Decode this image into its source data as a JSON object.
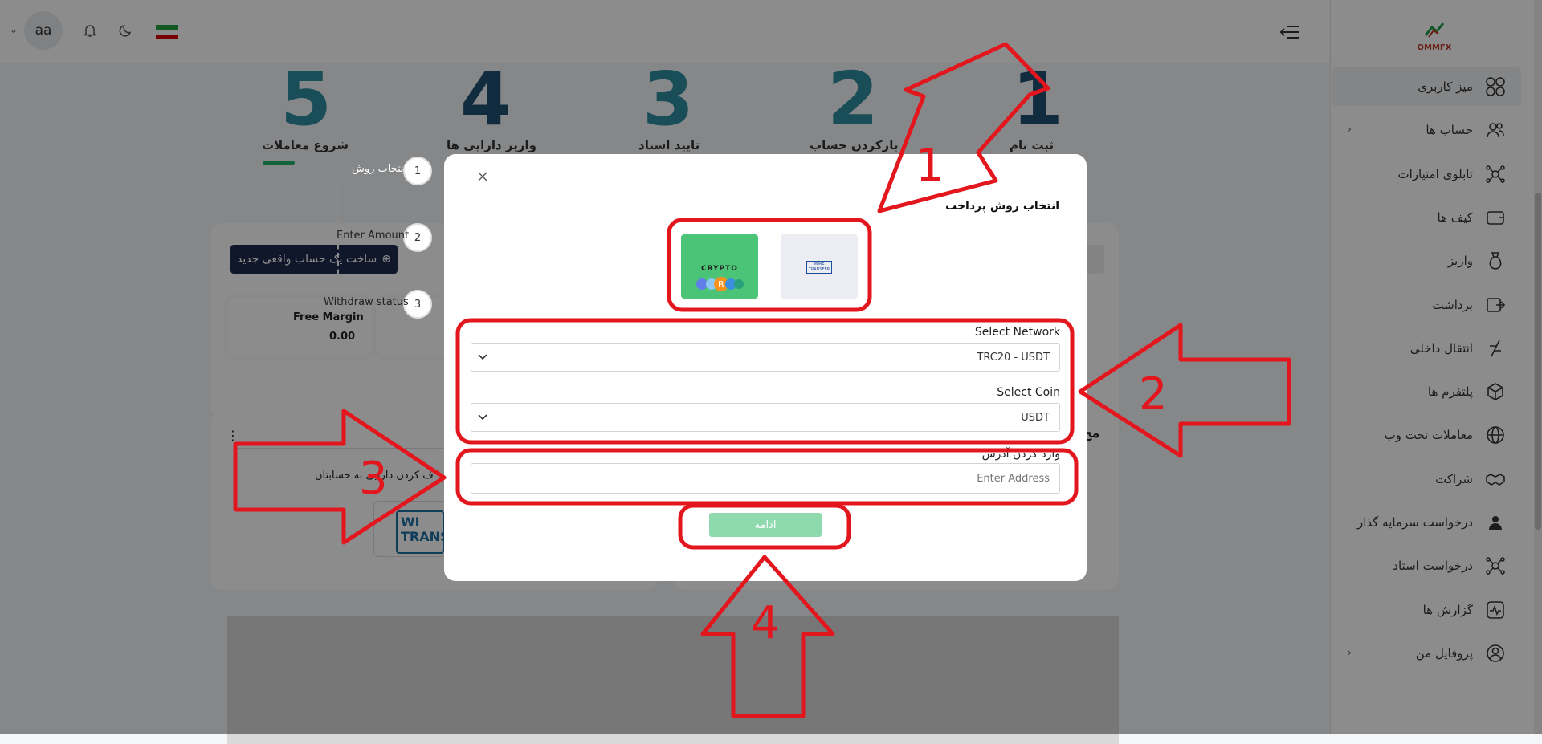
{
  "header": {
    "avatar_text": "aa",
    "icons": [
      "chevron-down-icon",
      "bell-icon",
      "moon-icon",
      "iran-flag-icon",
      "menu-collapse-icon"
    ]
  },
  "brand": {
    "logo_text": "OMMFX"
  },
  "sidebar": {
    "items": [
      {
        "label": "میز کاربری",
        "icon": "dashboard-grid-icon",
        "active": true
      },
      {
        "label": "حساب ها",
        "icon": "users-icon",
        "has_chevron": true
      },
      {
        "label": "تابلوی امتیازات",
        "icon": "network-icon"
      },
      {
        "label": "کیف ها",
        "icon": "wallet-icon"
      },
      {
        "label": "واریز",
        "icon": "money-bag-icon"
      },
      {
        "label": "برداشت",
        "icon": "withdraw-icon"
      },
      {
        "label": "انتقال داخلی",
        "icon": "transfer-icon"
      },
      {
        "label": "پلتفرم ها",
        "icon": "cube-icon"
      },
      {
        "label": "معاملات تحت وب",
        "icon": "globe-icon"
      },
      {
        "label": "شراکت",
        "icon": "handshake-icon"
      },
      {
        "label": "درخواست سرمایه گذار",
        "icon": "investor-icon"
      },
      {
        "label": "درخواست استاد",
        "icon": "network-icon"
      },
      {
        "label": "گزارش ها",
        "icon": "report-icon"
      },
      {
        "label": "پروفایل من",
        "icon": "profile-icon",
        "has_chevron": true
      }
    ]
  },
  "steps": [
    {
      "num": "1",
      "label": "ثبت نام"
    },
    {
      "num": "2",
      "label": "بازکردن حساب"
    },
    {
      "num": "3",
      "label": "تایید اسناد"
    },
    {
      "num": "4",
      "label": "واریز دارایی ها"
    },
    {
      "num": "5",
      "label": "شروع معاملات"
    }
  ],
  "content": {
    "new_account_button": "ساخت یک حساب واقعی جدید",
    "free_margin_label": "Free Margin",
    "free_margin_value": "0.00",
    "transfer_text": "ف کردن دارایی به حسابتان",
    "wire_logo_text": "WI TRANS",
    "section_title_partial": "مح"
  },
  "deposit_steps": [
    {
      "num": "1",
      "label": "انتخاب روش"
    },
    {
      "num": "2",
      "label": "Enter Amount"
    },
    {
      "num": "3",
      "label": "Withdraw status"
    }
  ],
  "modal": {
    "title": "انتخاب روش پرداخت",
    "payment_options": [
      {
        "name": "crypto",
        "label": "CRYPTO",
        "selected": true
      },
      {
        "name": "wire-transfer",
        "label": "WIRE TRANSFER",
        "selected": false
      }
    ],
    "network_label": "Select Network",
    "network_value": "TRC20 - USDT",
    "coin_label": "Select Coin",
    "coin_value": "USDT",
    "address_label": "وارد کردن آدرس",
    "address_placeholder": "Enter Address",
    "continue_button": "ادامه"
  },
  "annotations": [
    "1",
    "2",
    "3",
    "4"
  ],
  "colors": {
    "step_teal": "#2e8fa3",
    "step_navy": "#1f4f73",
    "annotation_red": "#e3161e",
    "accent_green": "#21b36a"
  }
}
